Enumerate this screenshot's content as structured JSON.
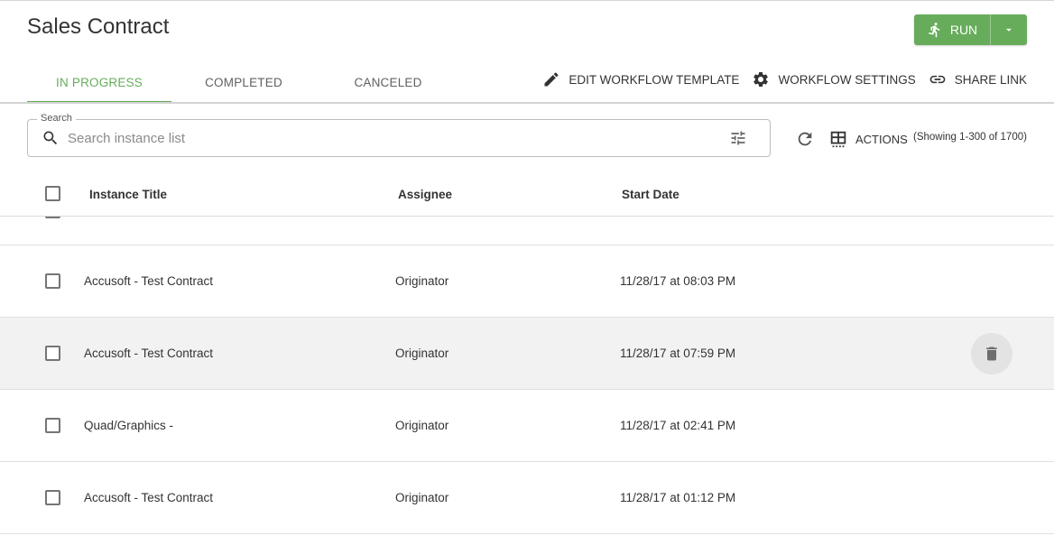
{
  "header": {
    "title": "Sales Contract",
    "run_label": "RUN"
  },
  "tabs": [
    {
      "label": "IN PROGRESS",
      "active": true
    },
    {
      "label": "COMPLETED",
      "active": false
    },
    {
      "label": "CANCELED",
      "active": false
    }
  ],
  "toolbar": {
    "edit_template": "EDIT WORKFLOW TEMPLATE",
    "settings": "WORKFLOW SETTINGS",
    "share": "SHARE LINK"
  },
  "search": {
    "legend": "Search",
    "placeholder": "Search instance list",
    "value": ""
  },
  "actions": {
    "label": "ACTIONS",
    "showing": "(Showing 1-300 of 1700)"
  },
  "table": {
    "columns": [
      "Instance Title",
      "Assignee",
      "Start Date"
    ],
    "rows": [
      {
        "title": "Accusoft - Test Contract",
        "assignee": "Originator",
        "start_date": "11/28/17 at 08:03 PM"
      },
      {
        "title": "Accusoft - Test Contract",
        "assignee": "Originator",
        "start_date": "11/28/17 at 07:59 PM"
      },
      {
        "title": "Quad/Graphics -",
        "assignee": "Originator",
        "start_date": "11/28/17 at 02:41 PM"
      },
      {
        "title": "Accusoft - Test Contract",
        "assignee": "Originator",
        "start_date": "11/28/17 at 01:12 PM"
      }
    ]
  },
  "colors": {
    "accent": "#67ac5b",
    "text": "#333333",
    "hover_row": "#f2f2f2"
  },
  "icons": {
    "run": "runner-icon",
    "run_menu": "caret-down-icon",
    "edit": "pencil-icon",
    "settings": "gear-icon",
    "share": "link-icon",
    "search": "search-icon",
    "filter": "filter-sliders-icon",
    "refresh": "refresh-icon",
    "actions": "table-columns-icon",
    "delete": "trash-icon"
  }
}
